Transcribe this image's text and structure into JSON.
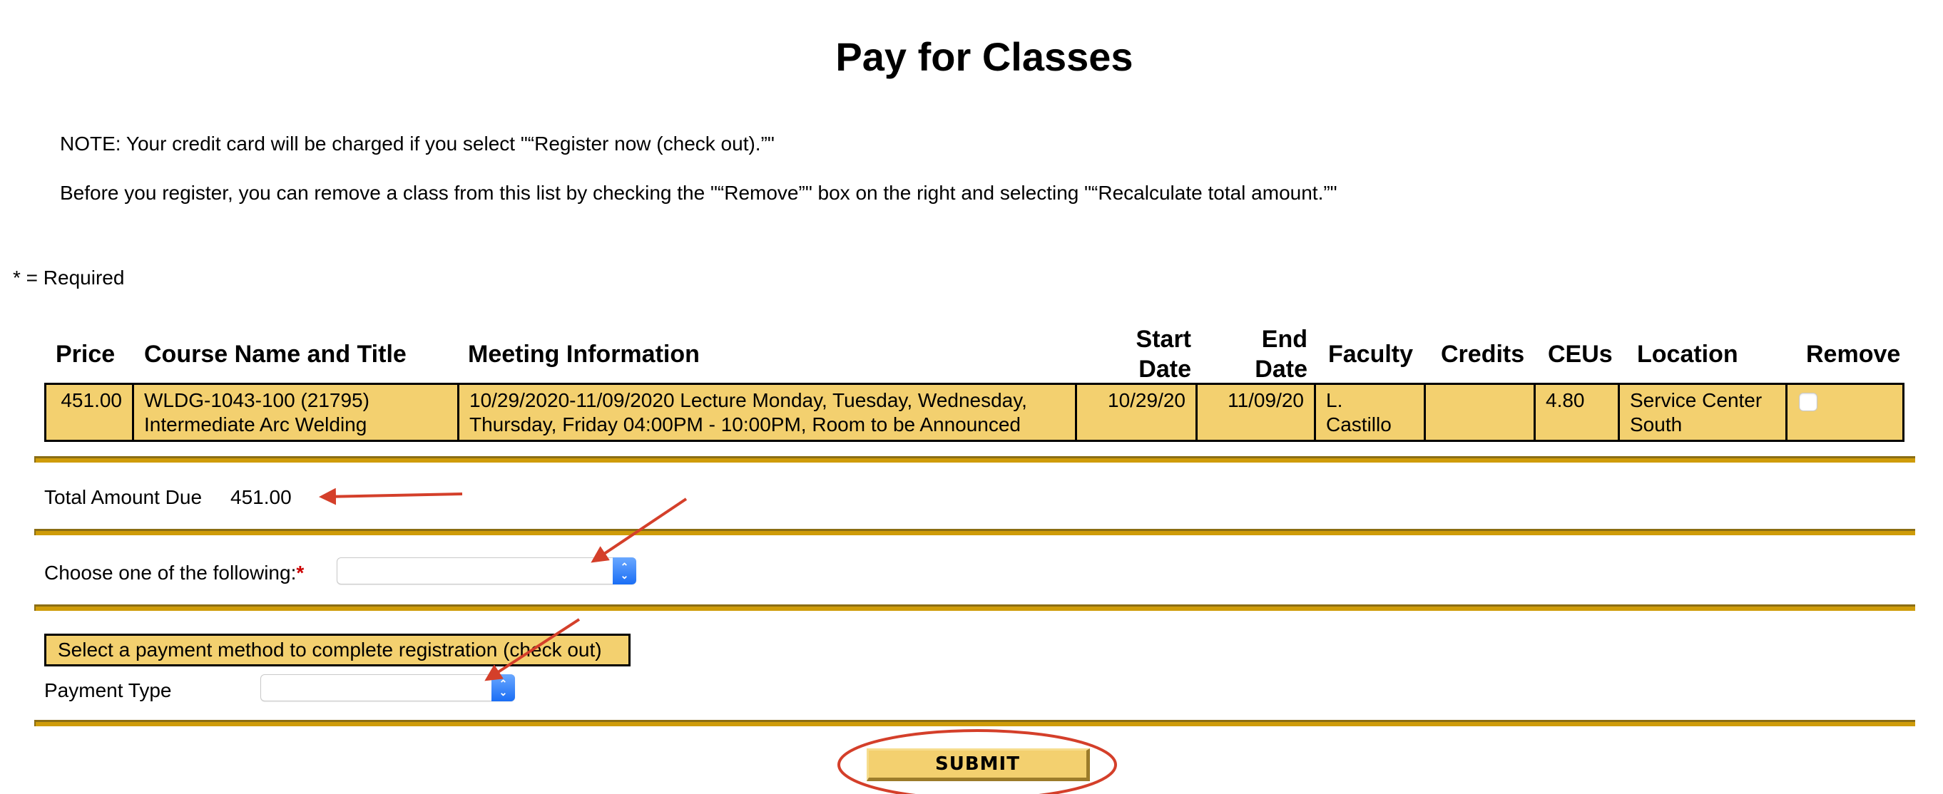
{
  "page": {
    "title": "Pay for Classes",
    "notes": [
      "NOTE: Your credit card will be charged if you select \"“Register now (check out).”\"",
      "Before you register, you can remove a class from this list by checking the \"“Remove”\" box on the right and selecting \"“Recalculate total amount.”\""
    ],
    "required_legend": "* = Required"
  },
  "table": {
    "headers": {
      "price": "Price",
      "course": "Course Name and Title",
      "meeting": "Meeting Information",
      "start_line1": "Start",
      "start_line2": "Date",
      "end_line1": "End",
      "end_line2": "Date",
      "faculty": "Faculty",
      "credits": "Credits",
      "ceus": "CEUs",
      "location": "Location",
      "remove": "Remove"
    },
    "rows": [
      {
        "price": "451.00",
        "course_code": "WLDG-1043-100 (21795)",
        "course_title": "Intermediate Arc Welding",
        "meeting_line1": "10/29/2020-11/09/2020 Lecture Monday, Tuesday, Wednesday,",
        "meeting_line2": "Thursday, Friday 04:00PM - 10:00PM, Room to be Announced",
        "start_date": "10/29/20",
        "end_date": "11/09/20",
        "faculty_line1": "L.",
        "faculty_line2": "Castillo",
        "credits": "",
        "ceus": "4.80",
        "location_line1": "Service Center",
        "location_line2": "South",
        "remove_checked": false
      }
    ]
  },
  "total": {
    "label": "Total Amount Due",
    "value": "451.00"
  },
  "choice": {
    "label": "Choose one of the following:",
    "required_mark": "*",
    "selected": ""
  },
  "payment": {
    "heading": "Select a payment method to complete registration (check out)",
    "type_label": "Payment Type",
    "selected": ""
  },
  "submit": {
    "label": "SUBMIT"
  },
  "colors": {
    "row_bg": "#f3d06f",
    "gold_bar": "#cf9c09",
    "annotation_red": "#d43f2a",
    "select_accent": "#1a6ef5"
  },
  "annotations": [
    {
      "type": "arrow",
      "target": "total-amount-value"
    },
    {
      "type": "arrow",
      "target": "choose-option-select"
    },
    {
      "type": "arrow",
      "target": "payment-type-select"
    },
    {
      "type": "ellipse",
      "target": "submit-button"
    }
  ]
}
